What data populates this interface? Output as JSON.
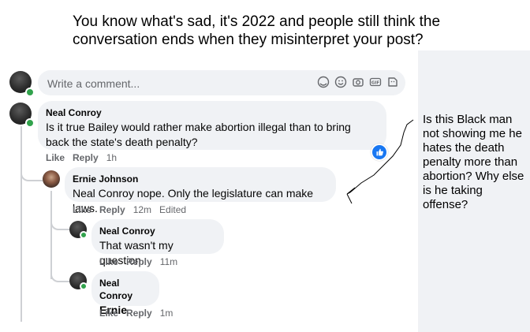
{
  "caption": "You know what's sad, it's 2022 and people still think the conversation ends when they misinterpret your post?",
  "side_note": "Is this Black man not showing me he hates the death penalty more than abortion? Why else is he taking offense?",
  "composer": {
    "placeholder": "Write a comment...",
    "icons": [
      "avatar-sticker-icon",
      "emoji-icon",
      "camera-icon",
      "gif-icon",
      "sticker-icon"
    ]
  },
  "actions": {
    "like": "Like",
    "reply": "Reply"
  },
  "comments": [
    {
      "author": "Neal Conroy",
      "text": "Is it true Bailey would rather make abortion illegal than to bring back the state's death penalty?",
      "time": "1h",
      "edited": "",
      "reaction": "like"
    },
    {
      "author": "Ernie Johnson",
      "text": "Neal Conroy nope. Only the legislature can make laws.",
      "time": "12m",
      "edited": "Edited"
    },
    {
      "author": "Neal Conroy",
      "text": "That wasn't my question.",
      "time": "11m",
      "edited": ""
    },
    {
      "author": "Neal Conroy",
      "text": "Ernie",
      "time": "1m",
      "edited": ""
    }
  ],
  "colors": {
    "bubble": "#f0f2f5",
    "muted": "#65676b",
    "online": "#31a24c",
    "like": "#1877f2"
  }
}
